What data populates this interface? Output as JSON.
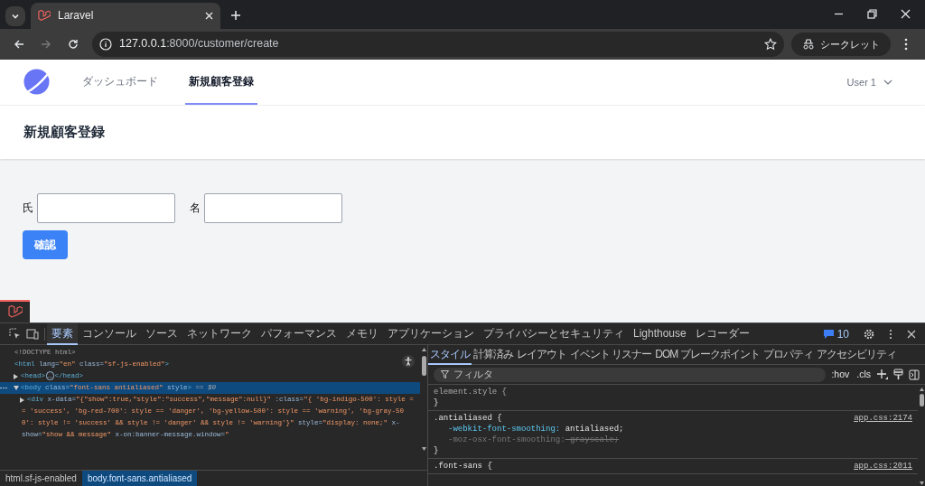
{
  "browser": {
    "tabs": [
      {
        "title": "Laravel",
        "selected": true
      }
    ],
    "back_disabled": false,
    "forward_disabled": true,
    "address": {
      "host": "127.0.0.1",
      "path": ":8000/customer/create"
    },
    "incognito_label": "シークレット"
  },
  "app": {
    "nav": [
      {
        "label": "ダッシュボード",
        "selected": false
      },
      {
        "label": "新規顧客登録",
        "selected": true
      }
    ],
    "user_menu": "User 1",
    "header": "新規顧客登録",
    "form": {
      "fields": [
        {
          "label": "氏"
        },
        {
          "label": "名"
        }
      ],
      "submit": "確認"
    }
  },
  "devtools": {
    "tabs": [
      {
        "label": "要素",
        "selected": true
      },
      {
        "label": "コンソール",
        "selected": false
      },
      {
        "label": "ソース",
        "selected": false
      },
      {
        "label": "ネットワーク",
        "selected": false
      },
      {
        "label": "パフォーマンス",
        "selected": false
      },
      {
        "label": "メモリ",
        "selected": false
      },
      {
        "label": "アプリケーション",
        "selected": false
      },
      {
        "label": "プライバシーとセキュリティ",
        "selected": false
      },
      {
        "label": "Lighthouse",
        "selected": false
      },
      {
        "label": "レコーダー",
        "selected": false
      }
    ],
    "issues_count": "10",
    "elements": {
      "nodes": [
        {
          "tokens": [
            {
              "kind": "comment",
              "text": "<!DOCTYPE html>"
            }
          ]
        },
        {
          "tokens": [
            {
              "kind": "tag",
              "text": "<html"
            },
            {
              "kind": "attr",
              "text": " lang"
            },
            {
              "kind": "attr",
              "text": "="
            },
            {
              "kind": "value",
              "text": "\"en\""
            },
            {
              "kind": "attr",
              "text": " class"
            },
            {
              "kind": "attr",
              "text": "="
            },
            {
              "kind": "value",
              "text": "\"sf-js-enabled\""
            },
            {
              "kind": "tag",
              "text": ">"
            }
          ],
          "children": [
            {
              "expanded": false,
              "selected": false,
              "tokens": [
                {
                  "kind": "tag",
                  "text": "<head>"
                },
                {
                  "kind": "ellipsis",
                  "text": "…"
                },
                {
                  "kind": "tag",
                  "text": "</head>"
                }
              ]
            },
            {
              "expanded": true,
              "selected": true,
              "tokens": [
                {
                  "kind": "tag",
                  "text": "<body"
                },
                {
                  "kind": "attr",
                  "text": " class"
                },
                {
                  "kind": "attr",
                  "text": "="
                },
                {
                  "kind": "value",
                  "text": "\"font-sans antialiased\""
                },
                {
                  "kind": "attr",
                  "text": " style"
                },
                {
                  "kind": "tag",
                  "text": ">"
                },
                {
                  "kind": "ref",
                  "text": " == $0"
                }
              ],
              "children": [
                {
                  "expanded": false,
                  "selected": false,
                  "tokens": [
                    {
                      "kind": "tag",
                      "text": "<div"
                    },
                    {
                      "kind": "attr",
                      "text": " x-data"
                    },
                    {
                      "kind": "attr",
                      "text": "="
                    },
                    {
                      "kind": "value",
                      "text": "\"{\"show\":true,\"style\":\"success\",\"message\":null}\""
                    },
                    {
                      "kind": "attr",
                      "text": " :class"
                    },
                    {
                      "kind": "attr",
                      "text": "="
                    },
                    {
                      "kind": "value",
                      "text": "\"{ 'bg-indigo-500': style ="
                    }
                  ],
                  "wrap": [
                    [
                      {
                        "kind": "value",
                        "text": "= 'success', 'bg-red-700': style == 'danger', 'bg-yellow-500': style == 'warning', 'bg-gray-50"
                      }
                    ],
                    [
                      {
                        "kind": "value",
                        "text": "0': style != 'success' && style != 'danger' && style != 'warning'}\""
                      },
                      {
                        "kind": "attr",
                        "text": " style"
                      },
                      {
                        "kind": "attr",
                        "text": "="
                      },
                      {
                        "kind": "value",
                        "text": "\"display: none;\""
                      },
                      {
                        "kind": "attr",
                        "text": " x-"
                      }
                    ],
                    [
                      {
                        "kind": "attr",
                        "text": "show"
                      },
                      {
                        "kind": "attr",
                        "text": "="
                      },
                      {
                        "kind": "value",
                        "text": "\"show && message\""
                      },
                      {
                        "kind": "attr",
                        "text": " x-on:banner-message.window"
                      },
                      {
                        "kind": "attr",
                        "text": "="
                      },
                      {
                        "kind": "value",
                        "text": "\""
                      }
                    ]
                  ]
                }
              ]
            }
          ]
        }
      ],
      "breadcrumbs": [
        {
          "label": "html.sf-js-enabled",
          "selected": false
        },
        {
          "label": "body.font-sans.antialiased",
          "selected": true
        }
      ]
    },
    "styles": {
      "tabs": [
        {
          "label": "スタイル",
          "selected": true
        },
        {
          "label": "計算済み",
          "selected": false
        },
        {
          "label": "レイアウト",
          "selected": false
        },
        {
          "label": "イベント リスナー",
          "selected": false
        },
        {
          "label": "DOM ブレークポイント",
          "selected": false
        },
        {
          "label": "プロパティ",
          "selected": false
        },
        {
          "label": "アクセシビリティ",
          "selected": false
        }
      ],
      "filter_placeholder": "フィルタ",
      "toggles": [
        ":hov",
        ".cls"
      ],
      "rules": [
        {
          "selector": "element.style {",
          "close": "}"
        },
        {
          "selector": ".antialiased {",
          "source": "app.css:2174",
          "close": "}",
          "declarations": [
            {
              "property": "-webkit-font-smoothing:",
              "value": "antialiased;",
              "overridden": false
            },
            {
              "property": "-moz-osx-font-smoothing:",
              "value": "grayscale;",
              "overridden": true
            }
          ]
        },
        {
          "selector": ".font-sans {",
          "source": "app.css:2011"
        }
      ]
    }
  }
}
